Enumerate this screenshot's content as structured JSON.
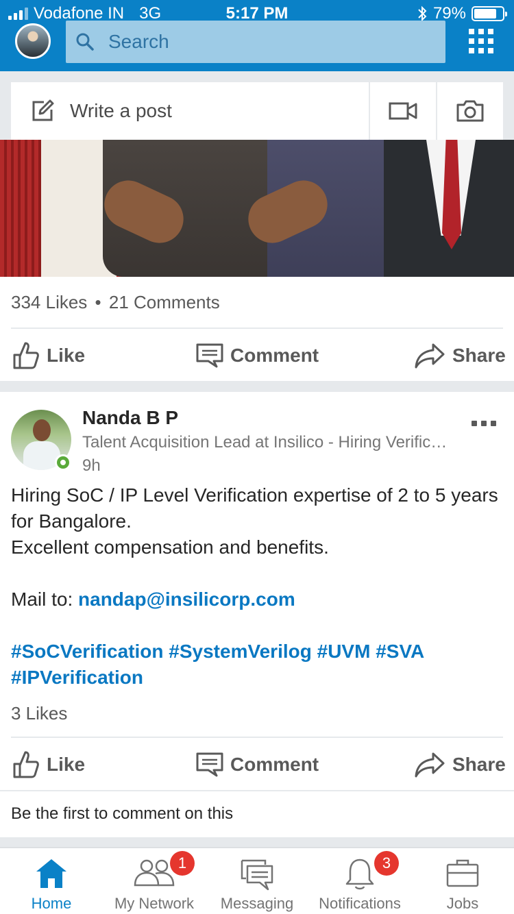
{
  "status_bar": {
    "carrier": "Vodafone IN",
    "network": "3G",
    "time": "5:17 PM",
    "battery": "79%",
    "battery_level": 0.79
  },
  "search": {
    "placeholder": "Search"
  },
  "share_box": {
    "write_label": "Write a post"
  },
  "post1": {
    "likes_count": "334 Likes",
    "comments_count": "21 Comments",
    "separator": "•",
    "actions": {
      "like": "Like",
      "comment": "Comment",
      "share": "Share"
    }
  },
  "post2": {
    "author_name": "Nanda B P",
    "author_headline": "Talent Acquisition Lead at Insilico - Hiring Verific…",
    "time": "9h",
    "body_line1": "Hiring SoC / IP Level Verification expertise of 2 to 5 years for Bangalore.",
    "body_line2": "Excellent compensation and benefits.",
    "mail_label": "Mail to: ",
    "email": "nandap@insilicorp.com",
    "hashtags_line1": "#SoCVerification #SystemVerilog #UVM #SVA",
    "hashtags_line2": "#IPVerification",
    "likes_count": "3 Likes",
    "actions": {
      "like": "Like",
      "comment": "Comment",
      "share": "Share"
    },
    "comment_prompt": "Be the first to comment on this"
  },
  "tabs": [
    {
      "label": "Home",
      "icon": "home-icon",
      "active": true
    },
    {
      "label": "My Network",
      "icon": "network-icon",
      "badge": "1"
    },
    {
      "label": "Messaging",
      "icon": "messaging-icon"
    },
    {
      "label": "Notifications",
      "icon": "bell-icon",
      "badge": "3"
    },
    {
      "label": "Jobs",
      "icon": "briefcase-icon"
    }
  ],
  "colors": {
    "brand_blue": "#0a81c7",
    "link_blue": "#0a78c2",
    "badge_red": "#e5362e",
    "online_green": "#5aaa3a"
  }
}
